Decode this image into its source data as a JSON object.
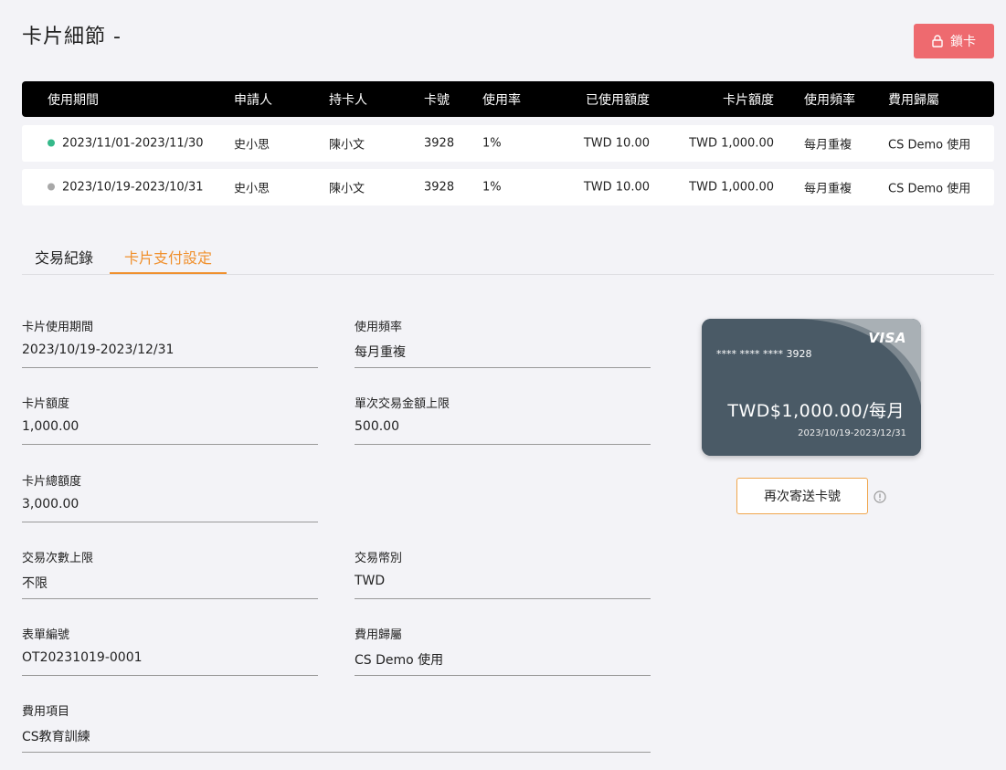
{
  "header": {
    "title": "卡片細節 -",
    "lock_label": "鎖卡"
  },
  "table": {
    "headers": [
      "使用期間",
      "申請人",
      "持卡人",
      "卡號",
      "使用率",
      "已使用額度",
      "卡片額度",
      "使用頻率",
      "費用歸屬"
    ],
    "rows": [
      {
        "status_color": "#35b98a",
        "period": "2023/11/01-2023/11/30",
        "applicant": "史小思",
        "holder": "陳小文",
        "card_no": "3928",
        "usage_rate": "1%",
        "used": "TWD 10.00",
        "limit": "TWD 1,000.00",
        "frequency": "每月重複",
        "cost_center": "CS Demo 使用"
      },
      {
        "status_color": "#a8a8a8",
        "period": "2023/10/19-2023/10/31",
        "applicant": "史小思",
        "holder": "陳小文",
        "card_no": "3928",
        "usage_rate": "1%",
        "used": "TWD 10.00",
        "limit": "TWD 1,000.00",
        "frequency": "每月重複",
        "cost_center": "CS Demo 使用"
      }
    ]
  },
  "tabs": {
    "transactions": "交易紀錄",
    "payment_settings": "卡片支付設定",
    "active": "payment_settings"
  },
  "fields": {
    "period": {
      "label": "卡片使用期間",
      "value": "2023/10/19-2023/12/31"
    },
    "frequency": {
      "label": "使用頻率",
      "value": "每月重複"
    },
    "card_limit": {
      "label": "卡片額度",
      "value": "1,000.00"
    },
    "per_txn_limit": {
      "label": "單次交易金額上限",
      "value": "500.00"
    },
    "total_limit": {
      "label": "卡片總額度",
      "value": "3,000.00"
    },
    "txn_count_limit": {
      "label": "交易次數上限",
      "value": "不限"
    },
    "currency": {
      "label": "交易幣別",
      "value": "TWD"
    },
    "form_no": {
      "label": "表單編號",
      "value": "OT20231019-0001"
    },
    "cost_center": {
      "label": "費用歸屬",
      "value": "CS Demo 使用"
    },
    "expense_item": {
      "label": "費用項目",
      "value": "CS教育訓練"
    }
  },
  "card": {
    "brand": "VISA",
    "masked_number": "**** **** **** 3928",
    "amount": "TWD$1,000.00/每月",
    "dates": "2023/10/19-2023/12/31"
  },
  "resend_label": "再次寄送卡號",
  "colors": {
    "accent": "#f0902d",
    "danger": "#ee6a6f",
    "card": "#4a5a66"
  }
}
